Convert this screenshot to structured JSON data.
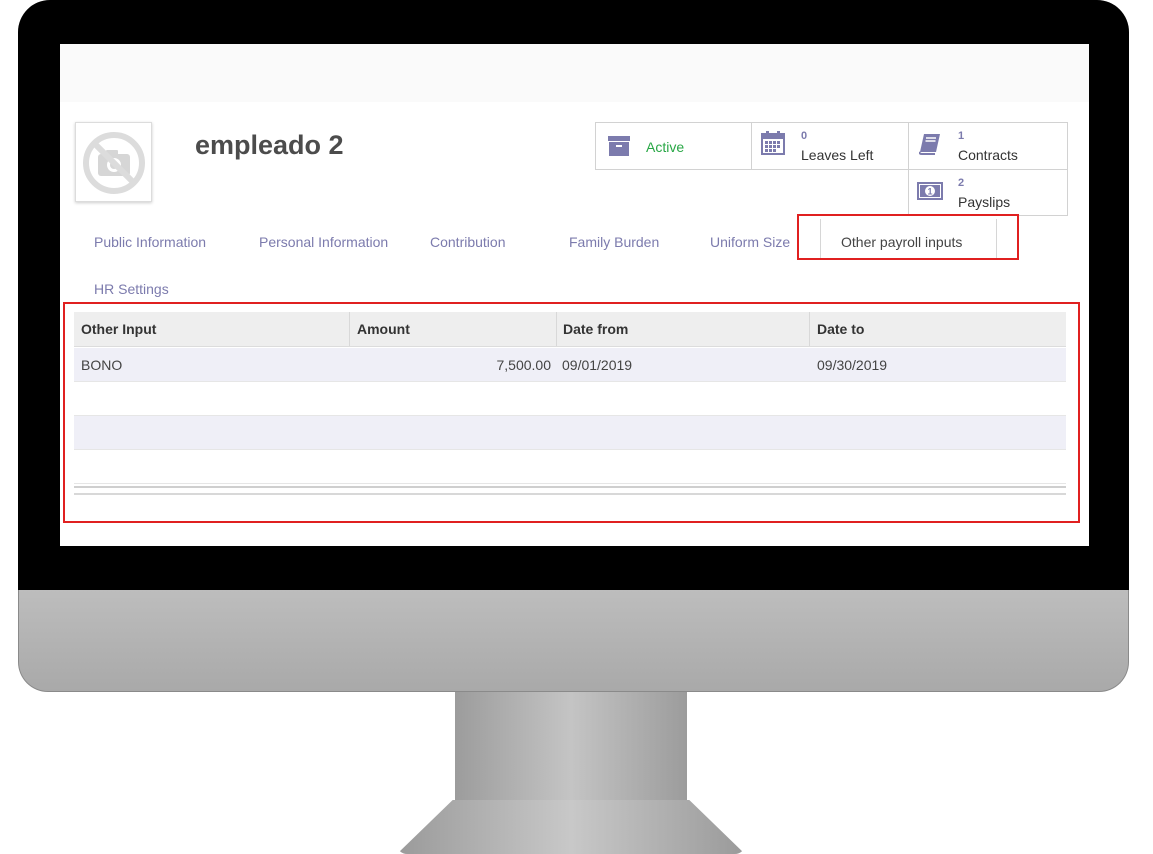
{
  "employee": {
    "name": "empleado 2"
  },
  "stat_buttons": {
    "active": {
      "label": "Active"
    },
    "leaves": {
      "count": "0",
      "label": "Leaves Left"
    },
    "contracts": {
      "count": "1",
      "label": "Contracts"
    },
    "payslips": {
      "count": "2",
      "label": "Payslips"
    }
  },
  "tabs": [
    {
      "label": "Public Information"
    },
    {
      "label": "Personal Information"
    },
    {
      "label": "Contribution"
    },
    {
      "label": "Family Burden"
    },
    {
      "label": "Uniform Size"
    },
    {
      "label": "Other payroll inputs",
      "active": true
    },
    {
      "label": "HR Settings"
    }
  ],
  "table": {
    "headers": [
      "Other Input",
      "Amount",
      "Date from",
      "Date to"
    ],
    "rows": [
      {
        "other_input": "BONO",
        "amount": "7,500.00",
        "date_from": "09/01/2019",
        "date_to": "09/30/2019"
      }
    ]
  },
  "colors": {
    "accent": "#7c7bad",
    "active_green": "#28a745",
    "annotation_red": "#e02020"
  }
}
